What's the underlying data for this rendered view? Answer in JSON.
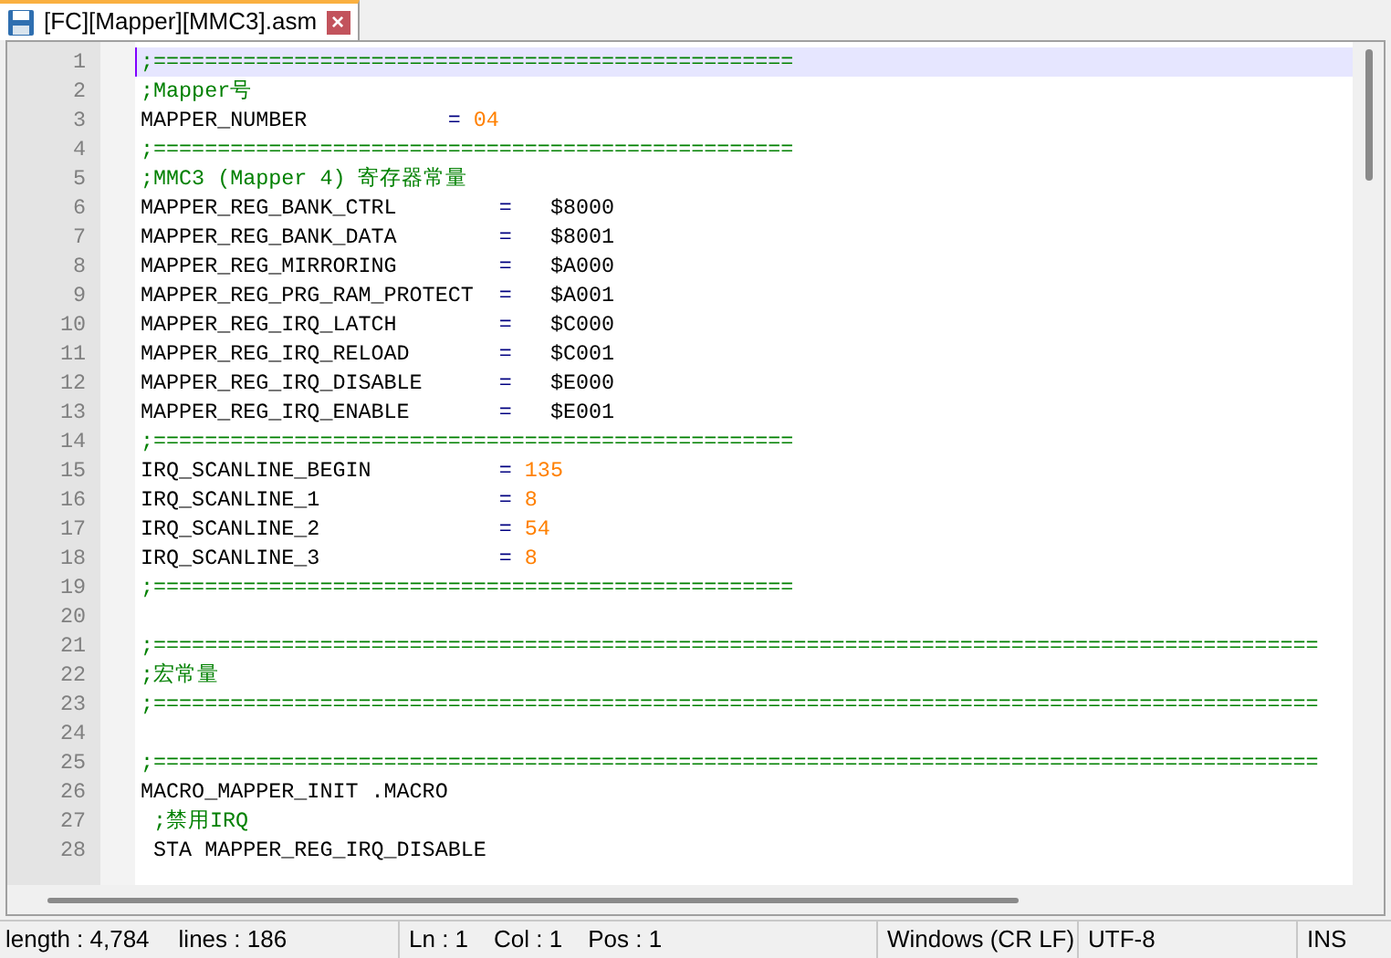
{
  "tab": {
    "title": "[FC][Mapper][MMC3].asm",
    "selected": true,
    "close": "×"
  },
  "lines": [
    {
      "number": "1",
      "current": true,
      "segments": [
        {
          "kind": "comment",
          "text": ";=================================================="
        }
      ]
    },
    {
      "number": "2",
      "current": false,
      "segments": [
        {
          "kind": "comment",
          "text": ";Mapper号"
        }
      ]
    },
    {
      "number": "3",
      "current": false,
      "segments": [
        {
          "kind": "text",
          "text": "MAPPER_NUMBER           "
        },
        {
          "kind": "operator",
          "text": "= "
        },
        {
          "kind": "number",
          "text": "04"
        }
      ]
    },
    {
      "number": "4",
      "current": false,
      "segments": [
        {
          "kind": "comment",
          "text": ";=================================================="
        }
      ]
    },
    {
      "number": "5",
      "current": false,
      "segments": [
        {
          "kind": "comment",
          "text": ";MMC3 (Mapper 4) 寄存器常量"
        }
      ]
    },
    {
      "number": "6",
      "current": false,
      "segments": [
        {
          "kind": "text",
          "text": "MAPPER_REG_BANK_CTRL        "
        },
        {
          "kind": "operator",
          "text": "="
        },
        {
          "kind": "text",
          "text": "   $8000"
        }
      ]
    },
    {
      "number": "7",
      "current": false,
      "segments": [
        {
          "kind": "text",
          "text": "MAPPER_REG_BANK_DATA        "
        },
        {
          "kind": "operator",
          "text": "="
        },
        {
          "kind": "text",
          "text": "   $8001"
        }
      ]
    },
    {
      "number": "8",
      "current": false,
      "segments": [
        {
          "kind": "text",
          "text": "MAPPER_REG_MIRRORING        "
        },
        {
          "kind": "operator",
          "text": "="
        },
        {
          "kind": "text",
          "text": "   $A000"
        }
      ]
    },
    {
      "number": "9",
      "current": false,
      "segments": [
        {
          "kind": "text",
          "text": "MAPPER_REG_PRG_RAM_PROTECT  "
        },
        {
          "kind": "operator",
          "text": "="
        },
        {
          "kind": "text",
          "text": "   $A001"
        }
      ]
    },
    {
      "number": "10",
      "current": false,
      "segments": [
        {
          "kind": "text",
          "text": "MAPPER_REG_IRQ_LATCH        "
        },
        {
          "kind": "operator",
          "text": "="
        },
        {
          "kind": "text",
          "text": "   $C000"
        }
      ]
    },
    {
      "number": "11",
      "current": false,
      "segments": [
        {
          "kind": "text",
          "text": "MAPPER_REG_IRQ_RELOAD       "
        },
        {
          "kind": "operator",
          "text": "="
        },
        {
          "kind": "text",
          "text": "   $C001"
        }
      ]
    },
    {
      "number": "12",
      "current": false,
      "segments": [
        {
          "kind": "text",
          "text": "MAPPER_REG_IRQ_DISABLE      "
        },
        {
          "kind": "operator",
          "text": "="
        },
        {
          "kind": "text",
          "text": "   $E000"
        }
      ]
    },
    {
      "number": "13",
      "current": false,
      "segments": [
        {
          "kind": "text",
          "text": "MAPPER_REG_IRQ_ENABLE       "
        },
        {
          "kind": "operator",
          "text": "="
        },
        {
          "kind": "text",
          "text": "   $E001"
        }
      ]
    },
    {
      "number": "14",
      "current": false,
      "segments": [
        {
          "kind": "comment",
          "text": ";=================================================="
        }
      ]
    },
    {
      "number": "15",
      "current": false,
      "segments": [
        {
          "kind": "text",
          "text": "IRQ_SCANLINE_BEGIN          "
        },
        {
          "kind": "operator",
          "text": "= "
        },
        {
          "kind": "number",
          "text": "135"
        }
      ]
    },
    {
      "number": "16",
      "current": false,
      "segments": [
        {
          "kind": "text",
          "text": "IRQ_SCANLINE_1              "
        },
        {
          "kind": "operator",
          "text": "= "
        },
        {
          "kind": "number",
          "text": "8"
        }
      ]
    },
    {
      "number": "17",
      "current": false,
      "segments": [
        {
          "kind": "text",
          "text": "IRQ_SCANLINE_2              "
        },
        {
          "kind": "operator",
          "text": "= "
        },
        {
          "kind": "number",
          "text": "54"
        }
      ]
    },
    {
      "number": "18",
      "current": false,
      "segments": [
        {
          "kind": "text",
          "text": "IRQ_SCANLINE_3              "
        },
        {
          "kind": "operator",
          "text": "= "
        },
        {
          "kind": "number",
          "text": "8"
        }
      ]
    },
    {
      "number": "19",
      "current": false,
      "segments": [
        {
          "kind": "comment",
          "text": ";=================================================="
        }
      ]
    },
    {
      "number": "20",
      "current": false
    },
    {
      "number": "21",
      "current": false,
      "segments": [
        {
          "kind": "comment",
          "text": ";==========================================================================================="
        }
      ]
    },
    {
      "number": "22",
      "current": false,
      "segments": [
        {
          "kind": "comment",
          "text": ";宏常量"
        }
      ]
    },
    {
      "number": "23",
      "current": false,
      "segments": [
        {
          "kind": "comment",
          "text": ";==========================================================================================="
        }
      ]
    },
    {
      "number": "24",
      "current": false
    },
    {
      "number": "25",
      "current": false,
      "segments": [
        {
          "kind": "comment",
          "text": ";==========================================================================================="
        }
      ]
    },
    {
      "number": "26",
      "current": false,
      "segments": [
        {
          "kind": "text",
          "text": "MACRO_MAPPER_INIT .MACRO"
        }
      ]
    },
    {
      "number": "27",
      "current": false,
      "segments": [
        {
          "kind": "comment",
          "text": " ;禁用IRQ"
        }
      ]
    },
    {
      "number": "28",
      "current": false,
      "segments": [
        {
          "kind": "text",
          "text": " STA MAPPER_REG_IRQ_DISABLE"
        }
      ]
    }
  ],
  "status_bar": {
    "length": "length : 4,784",
    "lines": "lines : 186",
    "ln": "Ln : 1",
    "col": "Col : 1",
    "pos": "Pos : 1",
    "eol": "Windows (CR LF)",
    "encoding": "UTF-8",
    "mode": "INS"
  }
}
